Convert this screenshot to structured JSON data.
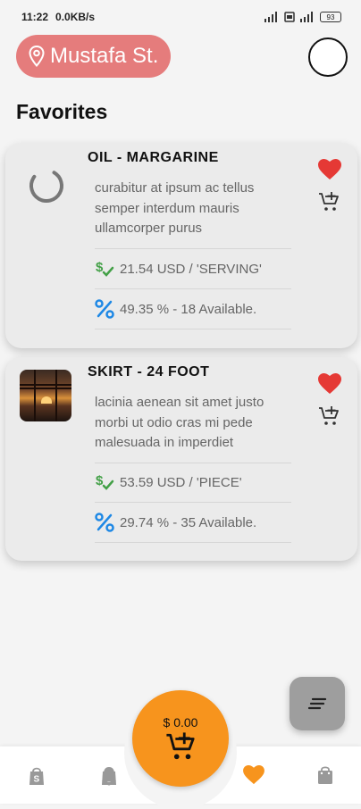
{
  "status_bar": {
    "time": "11:22",
    "network_speed": "0.0KB/s",
    "battery": "93"
  },
  "header": {
    "location": "Mustafa St.",
    "location_icon": "map-pin-icon",
    "avatar_icon": "avatar-circle"
  },
  "page": {
    "title": "Favorites"
  },
  "favorites": [
    {
      "title": "OIL - MARGARINE",
      "description": "curabitur at ipsum ac tellus semper interdum mauris ullamcorper purus",
      "price": "21.54 USD / 'SERVING'",
      "discount": "49.35 % - 18 Available.",
      "image": "loading-spinner",
      "favorited": true
    },
    {
      "title": "SKIRT - 24 FOOT",
      "description": "lacinia aenean sit amet justo morbi ut odio cras mi pede malesuada in imperdiet",
      "price": "53.59 USD / 'PIECE'",
      "discount": "29.74 % - 35 Available.",
      "image": "sunset-window-photo",
      "favorited": true
    }
  ],
  "cart": {
    "total": "$ 0.00"
  },
  "bottom_nav": {
    "items": [
      {
        "icon": "shopify-bag-icon",
        "active": false
      },
      {
        "icon": "bell-icon",
        "active": false
      },
      {
        "icon": "heart-icon",
        "active": true
      },
      {
        "icon": "shopping-bag-icon",
        "active": false
      }
    ]
  },
  "colors": {
    "accent_orange": "#f7941d",
    "location_pill": "#e57c7c",
    "heart_red": "#e53935",
    "price_green": "#43a047",
    "discount_blue": "#1e88e5"
  }
}
